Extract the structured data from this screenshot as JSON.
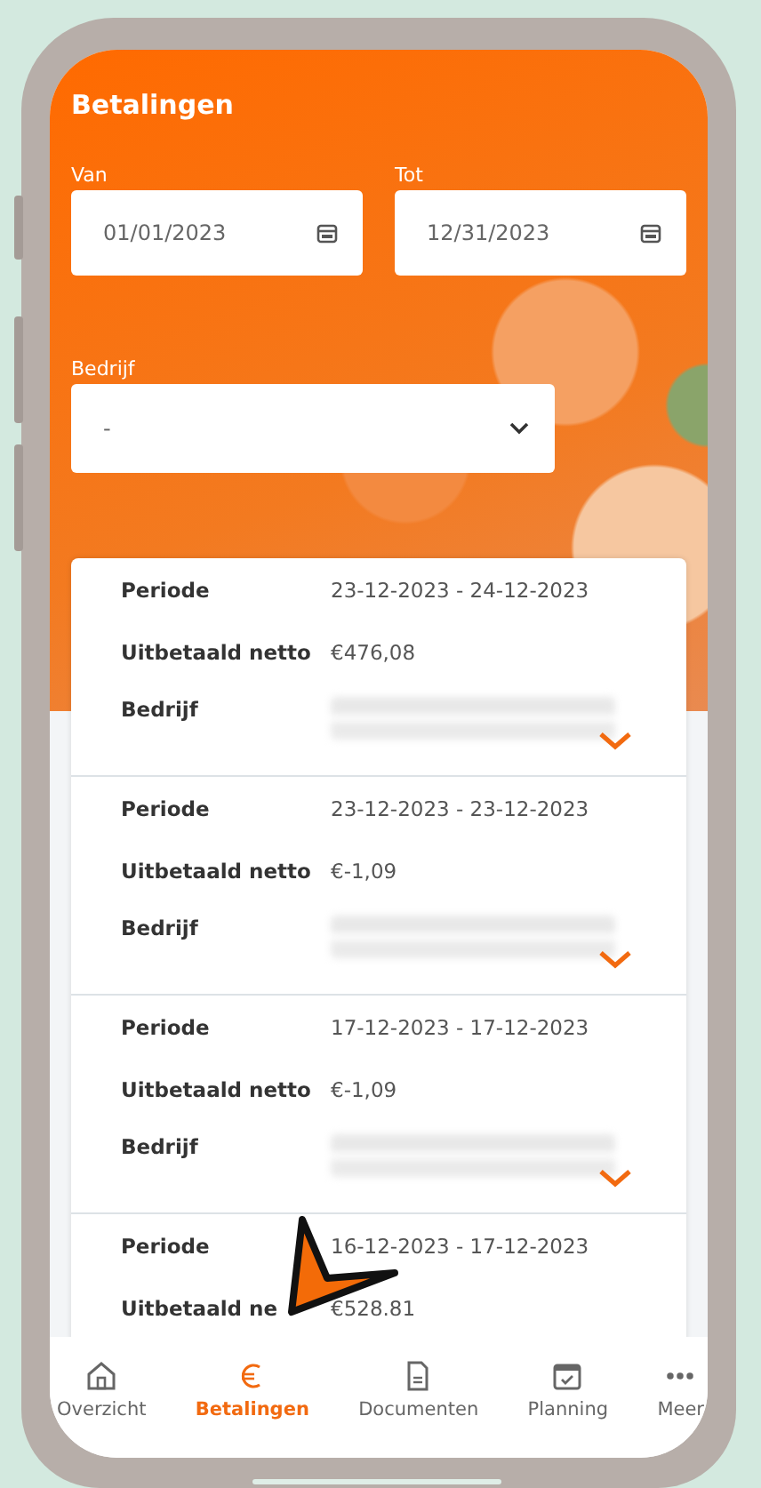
{
  "header": {
    "title": "Betalingen"
  },
  "filters": {
    "from": {
      "label": "Van",
      "value": "01/01/2023"
    },
    "to": {
      "label": "Tot",
      "value": "12/31/2023"
    },
    "company": {
      "label": "Bedrijf",
      "value": "-"
    }
  },
  "payments": [
    {
      "period_label": "Periode",
      "period": "23-12-2023 - 24-12-2023",
      "net_label": "Uitbetaald netto",
      "net": "€476,08",
      "company_label": "Bedrijf",
      "expanded": false
    },
    {
      "period_label": "Periode",
      "period": "23-12-2023 - 23-12-2023",
      "net_label": "Uitbetaald netto",
      "net": "€-1,09",
      "company_label": "Bedrijf",
      "expanded": false
    },
    {
      "period_label": "Periode",
      "period": "17-12-2023 - 17-12-2023",
      "net_label": "Uitbetaald netto",
      "net": "€-1,09",
      "company_label": "Bedrijf",
      "expanded": false
    },
    {
      "period_label": "Periode",
      "period": "16-12-2023 - 17-12-2023",
      "net_label": "Uitbetaald ne",
      "net": "€528.81"
    }
  ],
  "nav": [
    {
      "kind": "home",
      "label": "Overzicht",
      "selected": false
    },
    {
      "kind": "euro",
      "label": "Betalingen",
      "selected": true
    },
    {
      "kind": "document",
      "label": "Documenten",
      "selected": false
    },
    {
      "kind": "calendar",
      "label": "Planning",
      "selected": false
    },
    {
      "kind": "more",
      "label": "Meer",
      "selected": false
    }
  ]
}
